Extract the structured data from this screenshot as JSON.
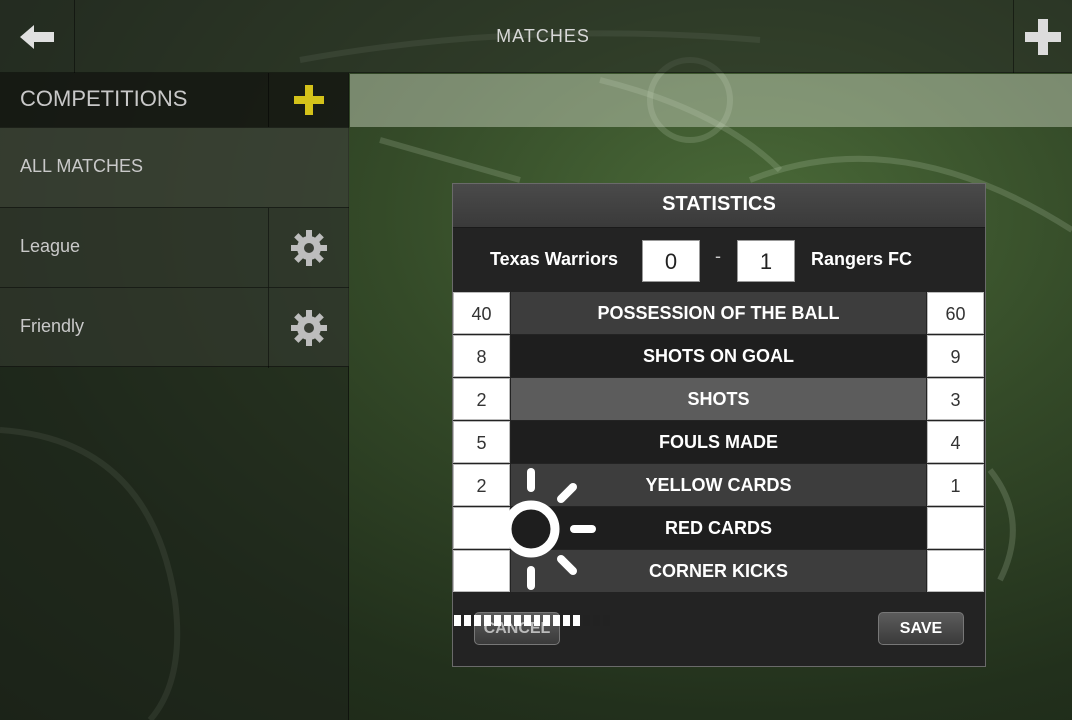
{
  "header": {
    "title": "MATCHES"
  },
  "sidebar": {
    "header_label": "COMPETITIONS",
    "items": [
      {
        "label": "ALL MATCHES"
      },
      {
        "label": "League"
      },
      {
        "label": "Friendly"
      }
    ]
  },
  "dialog": {
    "title": "STATISTICS",
    "home_team": "Texas Warriors",
    "away_team": "Rangers FC",
    "home_score": "0",
    "away_score": "1",
    "score_separator": "-",
    "stats": [
      {
        "name": "POSSESSION OF THE BALL",
        "home": "40",
        "away": "60"
      },
      {
        "name": "SHOTS ON GOAL",
        "home": "8",
        "away": "9"
      },
      {
        "name": "SHOTS",
        "home": "2",
        "away": "3"
      },
      {
        "name": "FOULS MADE",
        "home": "5",
        "away": "4"
      },
      {
        "name": "YELLOW CARDS",
        "home": "2",
        "away": "1"
      },
      {
        "name": "RED CARDS",
        "home": "",
        "away": ""
      },
      {
        "name": "CORNER KICKS",
        "home": "",
        "away": ""
      }
    ],
    "cancel_label": "CANCEL",
    "save_label": "SAVE"
  },
  "loading": {
    "progress_fraction": 0.82
  },
  "colors": {
    "accent_plus": "#d4c21a",
    "dialog_bg": "#232323",
    "gear": "#bdbdbd"
  },
  "icons": {
    "back": "arrow-left-icon",
    "add": "plus-icon",
    "settings": "gear-icon",
    "loading": "sun-spinner-icon"
  }
}
